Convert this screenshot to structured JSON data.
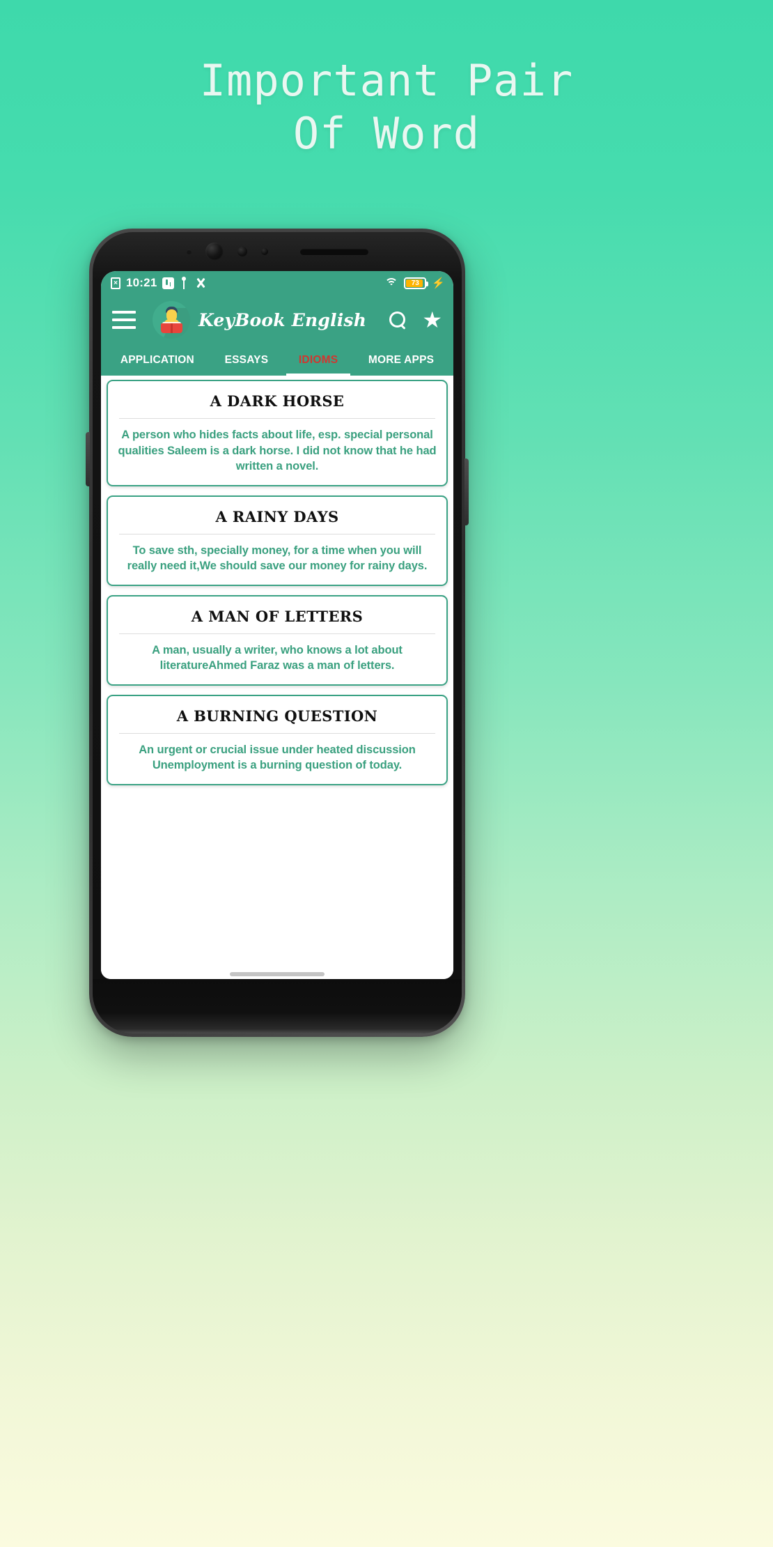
{
  "promo": {
    "line1": "Important  Pair",
    "line2": "Of Word",
    "text_color": "#e9f7f1"
  },
  "background": {
    "top_color": "#3ed9ab",
    "bottom_color": "#fbfbdf"
  },
  "status_bar": {
    "time": "10:21",
    "icons_left": [
      "file-x-icon",
      "badge-icon",
      "usb-icon",
      "developer-tools-icon"
    ],
    "icons_right": [
      "wifi-icon",
      "battery-icon",
      "charging-bolt-icon"
    ],
    "battery_percent": "73",
    "battery_fill_color": "#FFB300",
    "bolt": "⚡",
    "bar_color": "#3aa284"
  },
  "app_bar": {
    "menu_icon": "hamburger-menu-icon",
    "logo_icon": "reader-avatar-logo",
    "title": "KeyBook English",
    "search_icon": "search-icon",
    "favorite_icon": "star-icon",
    "star_glyph": "★",
    "bar_color": "#3aa284"
  },
  "tabs": {
    "active_index": 2,
    "active_color": "#d2362f",
    "inactive_color": "#ffffff",
    "items": [
      {
        "label": "APPLICATION"
      },
      {
        "label": "ESSAYS"
      },
      {
        "label": "IDIOMS"
      },
      {
        "label": "MORE APPS"
      }
    ]
  },
  "idiom_cards": [
    {
      "title": "A DARK HORSE",
      "body": "A person who hides facts about life, esp. special personal qualities Saleem is a dark horse. I did not know that he had written a novel."
    },
    {
      "title": "A RAINY DAYS",
      "body": "To save sth, specially money, for a time when you will really need it,We should save our money for rainy days."
    },
    {
      "title": "A MAN OF LETTERS",
      "body": "A man, usually a writer, who knows a lot about literatureAhmed Faraz was a man of letters."
    },
    {
      "title": "A BURNING QUESTION",
      "body": "An urgent or crucial issue under heated discussion Unemployment is a burning question of today."
    }
  ],
  "card_style": {
    "border_color": "#3aa284",
    "title_color": "#101010",
    "body_color": "#3aa07f"
  },
  "home_indicator": "home-gesture-bar"
}
